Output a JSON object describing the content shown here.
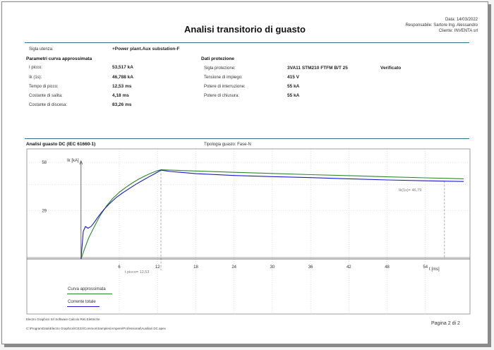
{
  "header": {
    "title": "Analisi transitorio di guasto",
    "date": "Data: 14/03/2022",
    "responsible": "Responsabile: Sartore Ing. Alessandro",
    "client": "Cliente: INVENTA srl"
  },
  "board": {
    "label": "Sigla utenza:",
    "value": "+Power plant.Aux substation-F"
  },
  "curve_params": {
    "heading": "Parametri curva approssimata",
    "rows": [
      {
        "label": "I picco:",
        "value": "53,517 kA"
      },
      {
        "label": "Ik (1s):",
        "value": "46,788 kA"
      },
      {
        "label": "Tempo di picco:",
        "value": "12,53 ms"
      },
      {
        "label": "Costante di salita:",
        "value": "4,18 ms"
      },
      {
        "label": "Costante di discesa:",
        "value": "83,26 ms"
      }
    ]
  },
  "protection": {
    "heading": "Dati protezione",
    "rows": [
      {
        "label": "Sigla protezione:",
        "value": "3VA11 STM210 FTFM B/T 25"
      },
      {
        "label": "Tensione di impiego:",
        "value": "415 V"
      },
      {
        "label": "Potere di interruzione:",
        "value": "55 kA"
      },
      {
        "label": "Potere di chiusura:",
        "value": "55 kA"
      }
    ],
    "status": "Verificato"
  },
  "analysis": {
    "title": "Analisi guasto DC (IEC 61660-1)",
    "fault_type": "Tipologia guasto: Fase-N"
  },
  "chart_data": {
    "type": "line",
    "ylabel": "Ik [kA]",
    "xlabel": "t [ms]",
    "xlim": [
      -8.5,
      61
    ],
    "ylim": [
      0,
      58
    ],
    "y_ticks": [
      "58",
      "29"
    ],
    "y_tick_values": [
      58,
      29
    ],
    "x_ticks": [
      "6",
      "12",
      "18",
      "24",
      "30",
      "36",
      "42",
      "48",
      "54"
    ],
    "x_tick_values": [
      6,
      12,
      18,
      24,
      30,
      36,
      42,
      48,
      54
    ],
    "annotations": {
      "peak_label": "t picco= 12,53",
      "peak_t": 12.53,
      "peak_i": 53.5,
      "ik_label": "Ik(1s)= 46,79",
      "ik_t": 57,
      "ik_i": 46.79
    },
    "colors": {
      "approx": "#2a8a2a",
      "total": "#1a1acc",
      "guide": "#777777"
    },
    "series": [
      {
        "name": "Curva approssimata",
        "x": [
          0,
          0.6,
          1.2,
          2,
          3,
          4,
          5,
          6,
          7,
          8,
          9,
          10,
          11,
          12,
          12.53,
          14,
          18,
          24,
          30,
          36,
          42,
          48,
          54,
          60
        ],
        "y": [
          0,
          6.5,
          12.6,
          18.8,
          26.1,
          31.8,
          36.4,
          40.0,
          42.9,
          45.5,
          47.8,
          49.8,
          51.5,
          53.0,
          53.5,
          53.3,
          52.8,
          52.0,
          51.3,
          50.6,
          50.0,
          49.3,
          48.7,
          48.1
        ]
      },
      {
        "name": "Corrente totale",
        "x": [
          0,
          0.35,
          0.7,
          1.1,
          1.6,
          2.1,
          2.8,
          3.5,
          4.5,
          5.5,
          6.5,
          7.5,
          8.5,
          9.5,
          10.5,
          11.5,
          12.53,
          14,
          18,
          24,
          30,
          36,
          42,
          48,
          54,
          60
        ],
        "y": [
          0,
          16.5,
          19.5,
          18.4,
          19.6,
          22.1,
          25.9,
          29.3,
          33.3,
          36.8,
          39.6,
          42.1,
          44.6,
          46.8,
          49.0,
          51.0,
          53.3,
          52.5,
          51.2,
          50.1,
          49.4,
          48.8,
          48.1,
          47.4,
          46.9,
          46.5
        ]
      }
    ]
  },
  "legend": [
    "Curva approssimata",
    "Corrente totale"
  ],
  "footer": {
    "software": "Electro Graphics Srl  Software Calcolo Reti Elettriche",
    "path": "C:\\ProgramData\\Electro Graphics\\ICE22\\Common\\Samples\\Ampere\\Professional\\Ausiliari DC.apex",
    "page": "Pagina 2 di 2"
  }
}
